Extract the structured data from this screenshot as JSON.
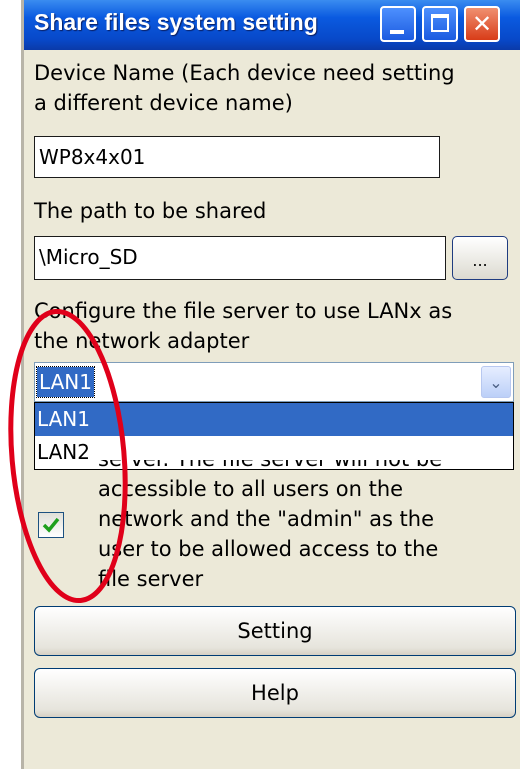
{
  "window": {
    "title": "Share files system setting",
    "close_glyph": "✕"
  },
  "device_name": {
    "label_line1": "Device Name (Each device need setting",
    "label_line2": "a different device name)",
    "value": "WP8x4x01"
  },
  "shared_path": {
    "label": "The path to be shared",
    "value": "\\Micro_SD",
    "browse_label": "..."
  },
  "network_adapter": {
    "label_line1": "Configure the file server to use LANx as",
    "label_line2": "the network adapter",
    "selected": "LAN1",
    "dropdown_arrow": "⌄",
    "options": [
      {
        "label": "LAN1",
        "highlighted": true
      },
      {
        "label": "LAN2",
        "highlighted": false
      }
    ]
  },
  "access_checkbox": {
    "checked": true,
    "text_line0": "server. The file server will not be",
    "text_line1": "accessible to all users on the",
    "text_line2": "network and the \"admin\" as the",
    "text_line3": "user to be allowed access to the",
    "text_line4": "file server"
  },
  "buttons": {
    "setting": "Setting",
    "help": "Help"
  },
  "colors": {
    "titlebar": "#0a5ae0",
    "selection": "#316ac5",
    "annotation": "#e0001a",
    "checkmark": "#1ea01e"
  },
  "icons": {
    "minimize": "minimize-icon",
    "maximize": "maximize-icon",
    "close": "close-icon",
    "dropdown": "chevron-down-icon",
    "check": "checkmark-icon"
  }
}
